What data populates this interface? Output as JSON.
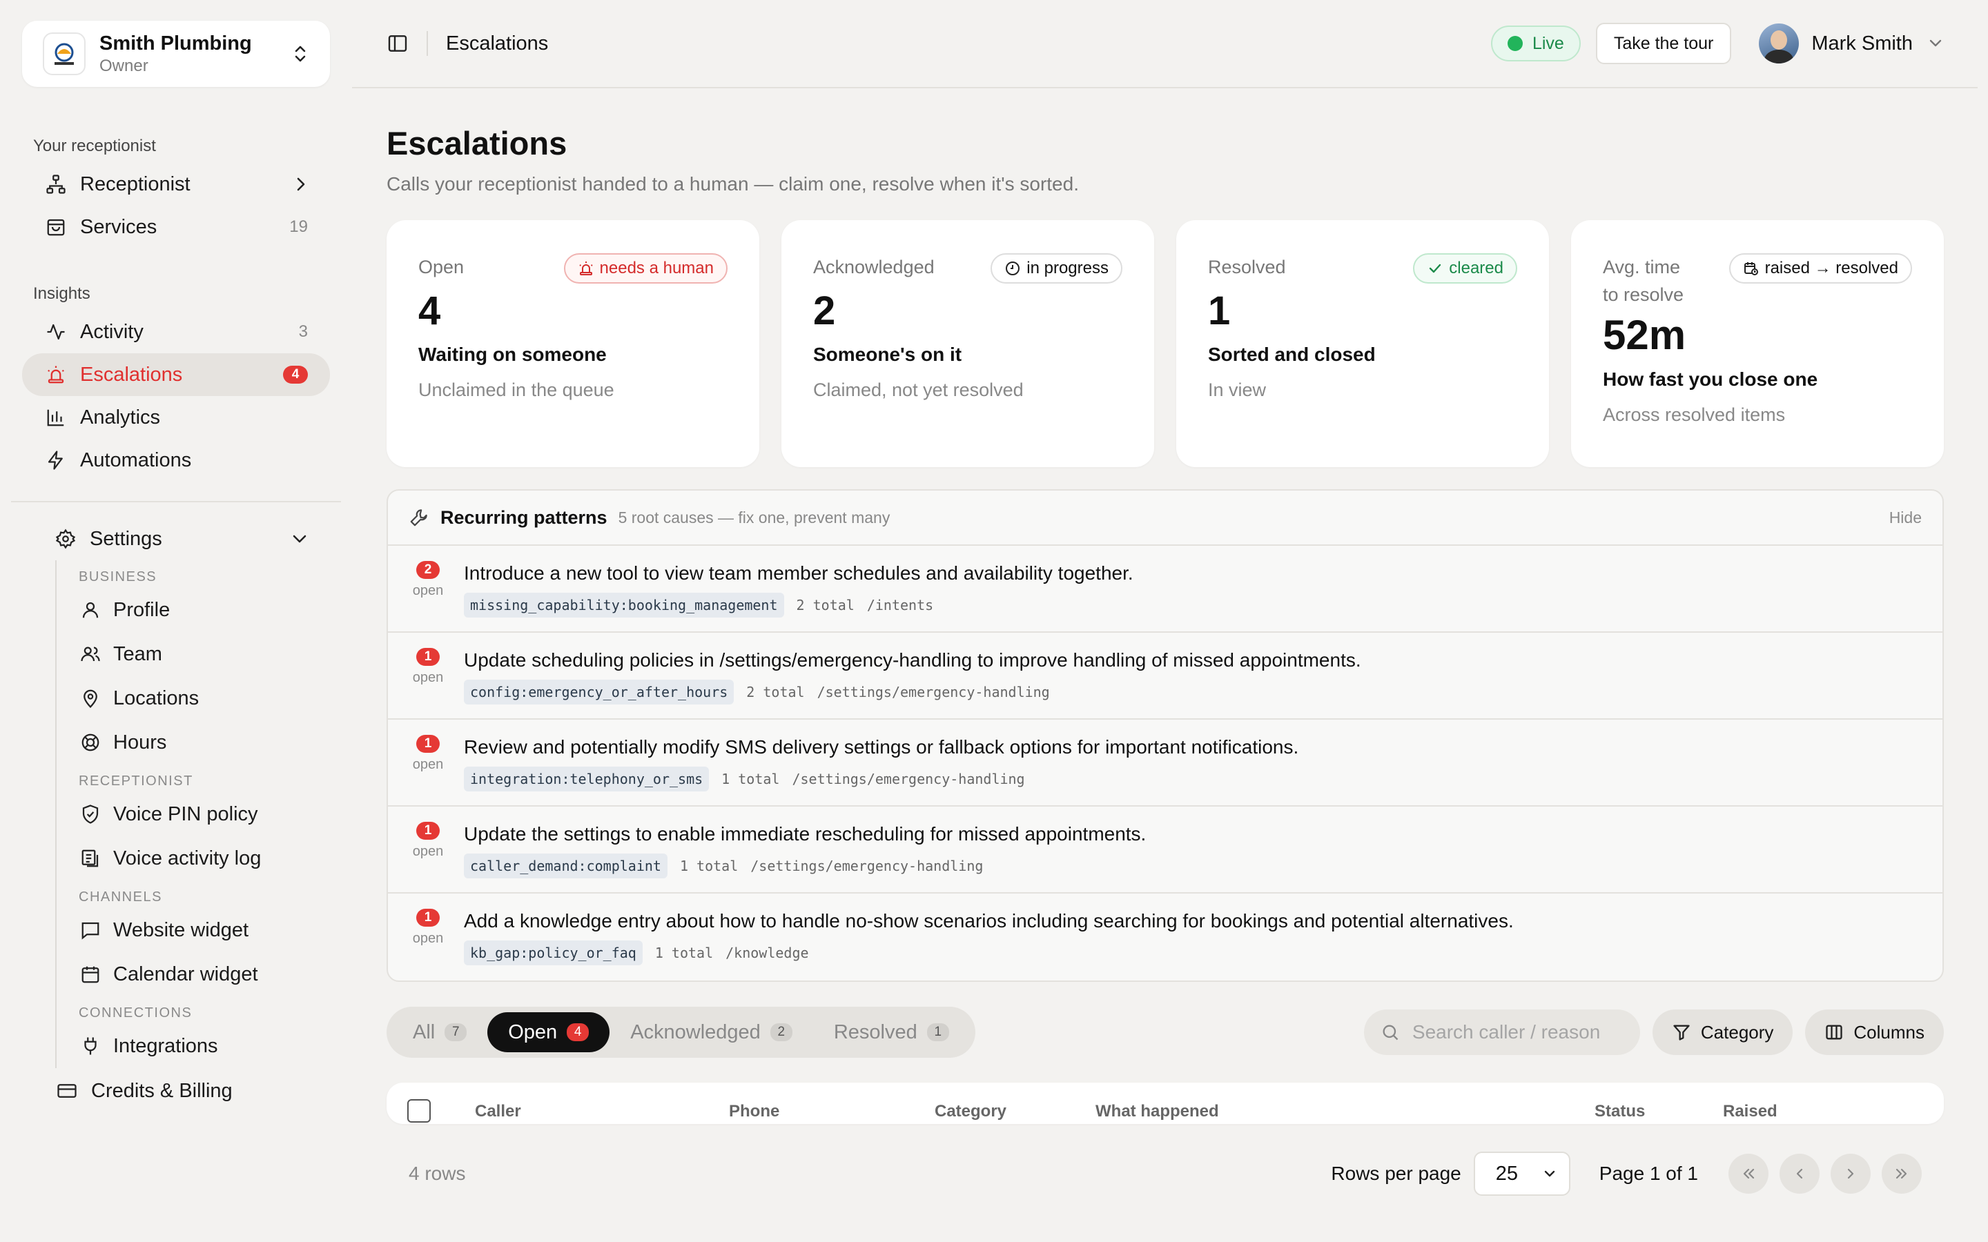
{
  "org": {
    "name": "Smith Plumbing",
    "role": "Owner"
  },
  "sidebar": {
    "section_receptionist": "Your receptionist",
    "receptionist_label": "Receptionist",
    "services_label": "Services",
    "services_count": "19",
    "section_insights": "Insights",
    "activity_label": "Activity",
    "activity_count": "3",
    "escalations_label": "Escalations",
    "escalations_count": "4",
    "analytics_label": "Analytics",
    "automations_label": "Automations",
    "settings_label": "Settings",
    "business_head": "BUSINESS",
    "profile_label": "Profile",
    "team_label": "Team",
    "locations_label": "Locations",
    "hours_label": "Hours",
    "receptionist_head": "RECEPTIONIST",
    "voice_pin_label": "Voice PIN policy",
    "voice_log_label": "Voice activity log",
    "channels_head": "CHANNELS",
    "website_widget_label": "Website widget",
    "calendar_widget_label": "Calendar widget",
    "connections_head": "CONNECTIONS",
    "integrations_label": "Integrations",
    "billing_label": "Credits & Billing"
  },
  "topbar": {
    "title": "Escalations",
    "live_label": "Live",
    "tour_label": "Take the tour",
    "user_name": "Mark Smith"
  },
  "header": {
    "title": "Escalations",
    "subtitle": "Calls your receptionist handed to a human — claim one, resolve when it's sorted."
  },
  "cards": [
    {
      "label": "Open",
      "tag": "needs a human",
      "value": "4",
      "title": "Waiting on someone",
      "desc": "Unclaimed in the queue"
    },
    {
      "label": "Acknowledged",
      "tag": "in progress",
      "value": "2",
      "title": "Someone's on it",
      "desc": "Claimed, not yet resolved"
    },
    {
      "label": "Resolved",
      "tag": "cleared",
      "value": "1",
      "title": "Sorted and closed",
      "desc": "In view"
    },
    {
      "label_line1": "Avg. time",
      "label_line2": "to resolve",
      "tag": "raised → resolved",
      "value": "52m",
      "title": "How fast you close one",
      "desc": "Across resolved items"
    }
  ],
  "patterns": {
    "title": "Recurring patterns",
    "subtitle": "5 root causes — fix one, prevent many",
    "hide_label": "Hide",
    "open_label": "open",
    "rows": [
      {
        "count": "2",
        "text": "Introduce a new tool to view team member schedules and availability together.",
        "code": "missing_capability:booking_management",
        "total": "2 total",
        "path": "/intents"
      },
      {
        "count": "1",
        "text": "Update scheduling policies in /settings/emergency-handling to improve handling of missed appointments.",
        "code": "config:emergency_or_after_hours",
        "total": "2 total",
        "path": "/settings/emergency-handling"
      },
      {
        "count": "1",
        "text": "Review and potentially modify SMS delivery settings or fallback options for important notifications.",
        "code": "integration:telephony_or_sms",
        "total": "1 total",
        "path": "/settings/emergency-handling"
      },
      {
        "count": "1",
        "text": "Update the settings to enable immediate rescheduling for missed appointments.",
        "code": "caller_demand:complaint",
        "total": "1 total",
        "path": "/settings/emergency-handling"
      },
      {
        "count": "1",
        "text": "Add a knowledge entry about how to handle no-show scenarios including searching for bookings and potential alternatives.",
        "code": "kb_gap:policy_or_faq",
        "total": "1 total",
        "path": "/knowledge"
      }
    ]
  },
  "filters": {
    "tabs": [
      {
        "label": "All",
        "count": "7"
      },
      {
        "label": "Open",
        "count": "4"
      },
      {
        "label": "Acknowledged",
        "count": "2"
      },
      {
        "label": "Resolved",
        "count": "1"
      }
    ],
    "search_placeholder": "Search caller / reason",
    "category_label": "Category",
    "columns_label": "Columns"
  },
  "table": {
    "columns": [
      "Caller",
      "Phone",
      "Category",
      "What happened",
      "Status",
      "Raised"
    ]
  },
  "footer": {
    "rows_count": "4 rows",
    "rows_per_page_label": "Rows per page",
    "rows_per_page_value": "25",
    "page_label": "Page 1 of 1"
  },
  "colors": {
    "accent_red": "#e53935",
    "live_green": "#22b45b",
    "background": "#f3f2f0"
  }
}
